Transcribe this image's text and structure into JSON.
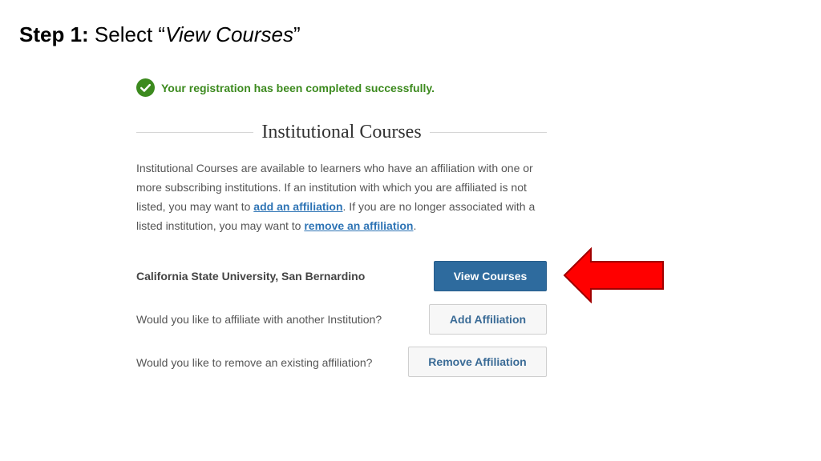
{
  "slide": {
    "step_label": "Step 1:",
    "step_text_prefix": " Select “",
    "step_text_emphasis": "View Courses",
    "step_text_suffix": "”"
  },
  "success_message": "Your registration has been completed successfully.",
  "section": {
    "title": "Institutional Courses",
    "description": {
      "part1": "Institutional Courses are available to learners who have an affiliation with one or more subscribing institutions. If an institution with which you are affiliated is not listed, you may want to ",
      "link_add": "add an affiliation",
      "part2": ". If you are no longer associated with a listed institution, you may want to ",
      "link_remove": "remove an affiliation",
      "part3": "."
    }
  },
  "rows": {
    "institution_name": "California State University, San Bernardino",
    "view_courses_button": "View Courses",
    "affiliate_question": "Would you like to affiliate with another Institution?",
    "add_affiliation_button": "Add Affiliation",
    "remove_question": "Would you like to remove an existing affiliation?",
    "remove_affiliation_button": "Remove Affiliation"
  },
  "icons": {
    "success": "check-circle-icon",
    "pointer": "arrow-left-icon"
  },
  "colors": {
    "success_green": "#3c8a1e",
    "link_blue": "#2e74b5",
    "primary_button": "#2e6b9e",
    "arrow_red": "#ff0000"
  }
}
